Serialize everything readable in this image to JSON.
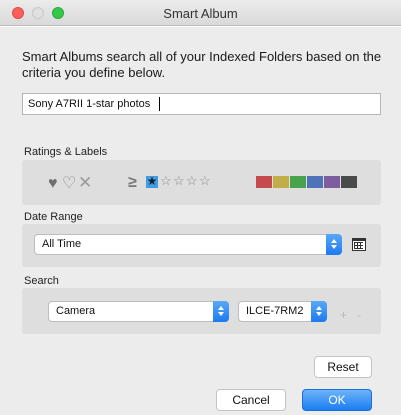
{
  "window": {
    "title": "Smart Album"
  },
  "description": "Smart Albums search all of your Indexed Folders based on the criteria you define below.",
  "album_name": {
    "value": "Sony A7RII 1-star photos"
  },
  "ratings_labels": {
    "label": "Ratings & Labels",
    "pick_flags": [
      "heart-filled-icon",
      "heart-outline-icon",
      "reject-x-icon"
    ],
    "rating_operator": "≥",
    "rating_selected": 1,
    "rating_max": 5,
    "color_labels": [
      "#c44a4d",
      "#c1ae48",
      "#49a34d",
      "#4e73b8",
      "#7d5d9d",
      "#4a4a4a"
    ]
  },
  "date_range": {
    "label": "Date Range",
    "selected": "All Time"
  },
  "search": {
    "label": "Search",
    "field": "Camera",
    "value": "ILCE-7RM2",
    "add_label": "+",
    "remove_label": "-"
  },
  "buttons": {
    "reset": "Reset",
    "cancel": "Cancel",
    "ok": "OK"
  }
}
